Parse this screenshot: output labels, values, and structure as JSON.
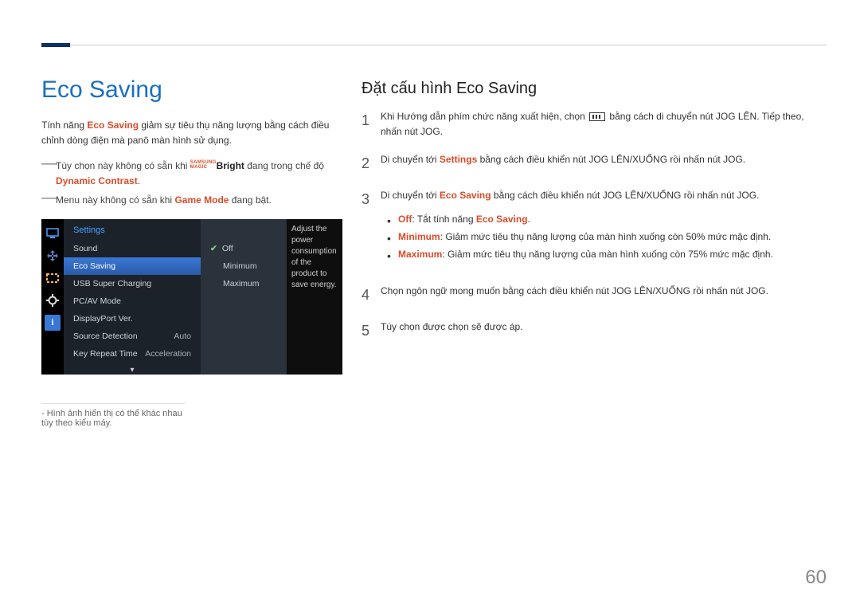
{
  "page_number": "60",
  "left": {
    "title": "Eco Saving",
    "intro_plain_1": "Tính năng ",
    "intro_kw_1": "Eco Saving",
    "intro_plain_2": " giảm sự tiêu thụ năng lượng bằng cách điều chỉnh dòng điện mà panô màn hình sử dụng.",
    "note1_lead": "Tùy chọn này không có sẵn khi ",
    "note1_magic_samsung": "SAMSUNG",
    "note1_magic_magic": "MAGIC",
    "note1_bright": "Bright",
    "note1_tail": " đang trong chế độ ",
    "note1_dynamic": "Dynamic Contrast",
    "note1_end": ".",
    "note2_lead": "Menu này không có sẵn khi ",
    "note2_game": "Game Mode",
    "note2_tail": " đang bật.",
    "osd": {
      "header": "Settings",
      "items": [
        {
          "label": "Sound",
          "val": ""
        },
        {
          "label": "Eco Saving",
          "val": ""
        },
        {
          "label": "USB Super Charging",
          "val": ""
        },
        {
          "label": "PC/AV Mode",
          "val": ""
        },
        {
          "label": "DisplayPort Ver.",
          "val": ""
        },
        {
          "label": "Source Detection",
          "val": "Auto"
        },
        {
          "label": "Key Repeat Time",
          "val": "Acceleration"
        }
      ],
      "sub": [
        "Off",
        "Minimum",
        "Maximum"
      ],
      "desc": "Adjust the power consumption of the product to save energy."
    },
    "footnote_dash": "-",
    "footnote": "Hình ảnh hiển thị có thể khác nhau tùy theo kiểu máy."
  },
  "right": {
    "section_title": "Đặt cấu hình Eco Saving",
    "steps": {
      "s1_a": "Khi Hướng dẫn phím chức năng xuất hiện, chọn ",
      "s1_b": " bằng cách di chuyển nút JOG LÊN. Tiếp theo, nhấn nút JOG.",
      "s2_a": "Di chuyển tới ",
      "s2_kw": "Settings",
      "s2_b": " bằng cách điều khiển nút JOG LÊN/XUỐNG rồi nhấn nút JOG.",
      "s3_a": "Di chuyển tới ",
      "s3_kw": "Eco Saving",
      "s3_b": " bằng cách điều khiển nút JOG LÊN/XUỐNG rồi nhấn nút JOG.",
      "bullets": {
        "b1_kw": "Off",
        "b1_mid": ": Tắt tính năng ",
        "b1_kw2": "Eco Saving",
        "b1_end": ".",
        "b2_kw": "Minimum",
        "b2_txt": ": Giảm mức tiêu thụ năng lượng của màn hình xuống còn 50% mức mặc định.",
        "b3_kw": "Maximum",
        "b3_txt": ": Giảm mức tiêu thụ năng lượng của màn hình xuống còn 75% mức mặc định."
      },
      "s4": "Chọn ngôn ngữ mong muốn bằng cách điều khiển nút JOG LÊN/XUỐNG rồi nhấn nút JOG.",
      "s5": "Tùy chọn được chọn sẽ được áp."
    },
    "nums": {
      "n1": "1",
      "n2": "2",
      "n3": "3",
      "n4": "4",
      "n5": "5"
    }
  }
}
